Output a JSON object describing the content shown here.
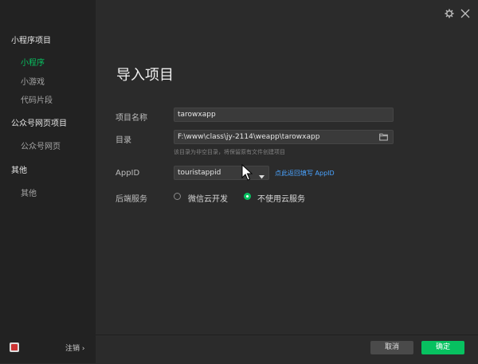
{
  "sidebar": {
    "groups": [
      {
        "label": "小程序项目",
        "items": [
          {
            "label": "小程序",
            "active": true
          },
          {
            "label": "小游戏"
          },
          {
            "label": "代码片段"
          }
        ]
      },
      {
        "label": "公众号网页项目",
        "items": [
          {
            "label": "公众号网页"
          }
        ]
      },
      {
        "label": "其他",
        "items": [
          {
            "label": "其他"
          }
        ]
      }
    ],
    "logout_label": "注销 ›"
  },
  "main": {
    "title": "导入项目",
    "fields": {
      "project_name": {
        "label": "项目名称",
        "value": "tarowxapp"
      },
      "directory": {
        "label": "目录",
        "value": "F:\\www\\class\\jy-2114\\weapp\\tarowxapp",
        "hint": "该目录为非空目录，将保留原有文件创建项目"
      },
      "appid": {
        "label": "AppID",
        "value": "touristappid",
        "link": "点此返回填写 AppID"
      },
      "backend": {
        "label": "后端服务",
        "options": [
          {
            "label": "微信云开发",
            "checked": false
          },
          {
            "label": "不使用云服务",
            "checked": true
          }
        ]
      }
    }
  },
  "buttons": {
    "cancel": "取消",
    "ok": "确定"
  },
  "icons": {
    "settings": "gear-icon",
    "close": "close-icon",
    "folder": "folder-icon",
    "dropdown": "chevron-down-icon",
    "cursor": "mouse-cursor-icon"
  },
  "colors": {
    "accent": "#07c160",
    "link": "#4aa3ff",
    "sidebar_bg": "#222222",
    "main_bg": "#2b2b2b"
  }
}
